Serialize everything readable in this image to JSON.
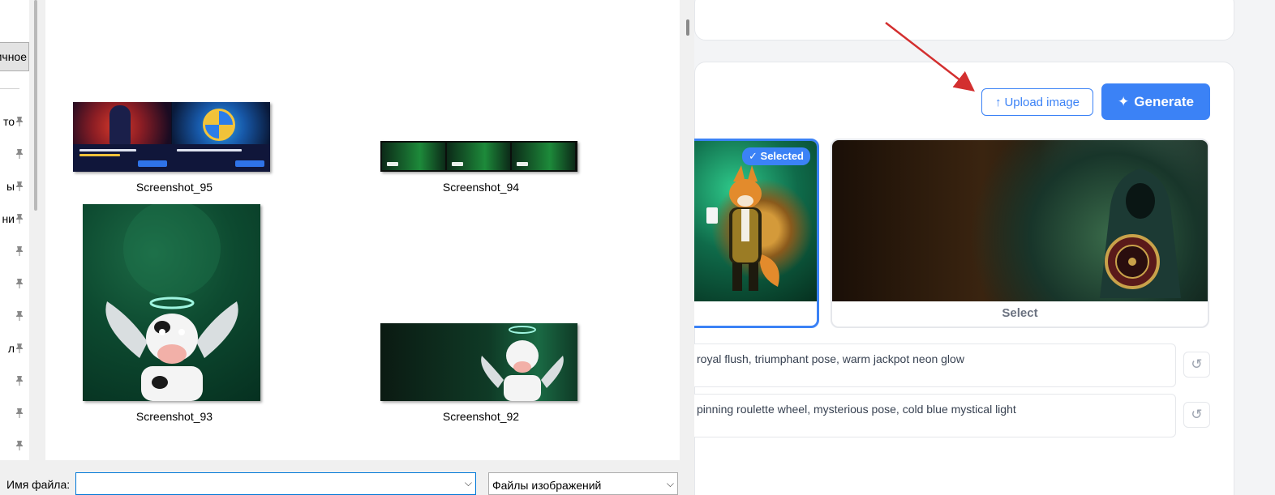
{
  "webapp": {
    "upload_label": "Upload image",
    "upload_icon": "↑",
    "generate_label": "Generate",
    "generate_icon": "✦",
    "options": [
      {
        "badge": "✓ Selected"
      },
      {
        "select_label": "Select"
      }
    ],
    "prompts": [
      {
        "text": "royal flush, triumphant pose, warm jackpot neon glow",
        "reset_icon": "↺"
      },
      {
        "text": "pinning roulette wheel, mysterious pose, cold blue mystical light",
        "reset_icon": "↺"
      }
    ],
    "colors": {
      "accent": "#3b82f6",
      "annotation_arrow": "#d32f2f"
    }
  },
  "dialog": {
    "nav_button_label": "Личное",
    "nav_items": [
      {
        "label": "то"
      },
      {
        "label": ""
      },
      {
        "label": "ы"
      },
      {
        "label": "ни"
      },
      {
        "label": ""
      },
      {
        "label": ""
      },
      {
        "label": ""
      },
      {
        "label": "л"
      },
      {
        "label": ""
      },
      {
        "label": ""
      },
      {
        "label": ""
      }
    ],
    "pin_icon": "pin-icon",
    "files": [
      {
        "name": "Screenshot_95"
      },
      {
        "name": "Screenshot_94"
      },
      {
        "name": "Screenshot_93"
      },
      {
        "name": "Screenshot_92"
      }
    ],
    "file_name_label": "Имя файла:",
    "file_name_value": "",
    "file_type_selected": "Файлы изображений"
  }
}
